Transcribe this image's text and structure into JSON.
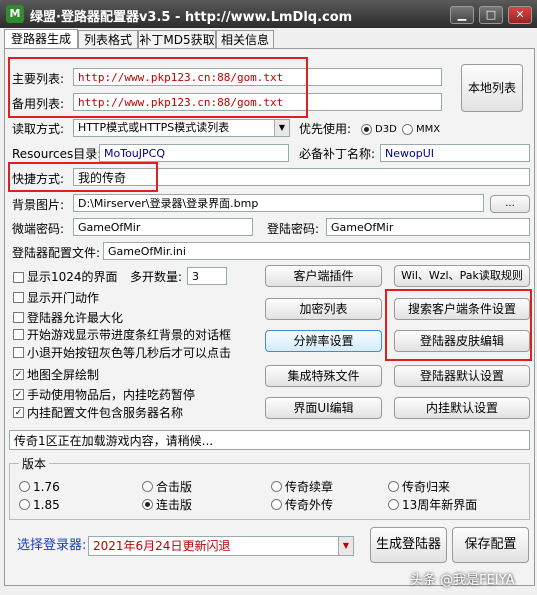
{
  "window": {
    "title": "绿盟·登路器配置器v3.5 - http://www.LmDlq.com",
    "icon_letter": "M",
    "buttons": {
      "minimize": "▁",
      "maximize": "□",
      "close": "✕"
    }
  },
  "tabs": [
    {
      "label": "登路器生成",
      "active": true
    },
    {
      "label": "列表格式",
      "active": false
    },
    {
      "label": "补丁MD5获取",
      "active": false
    },
    {
      "label": "相关信息",
      "active": false
    }
  ],
  "form": {
    "main_list": {
      "label": "主要列表:",
      "value": "http://www.pkp123.cn:88/gom.txt"
    },
    "backup_list": {
      "label": "备用列表:",
      "value": "http://www.pkp123.cn:88/gom.txt"
    },
    "local_list_button": "本地列表",
    "read_mode": {
      "label": "读取方式:",
      "value": "HTTP模式或HTTPS模式读列表"
    },
    "priority": {
      "label": "优先使用:",
      "options": [
        "D3D",
        "MMX"
      ],
      "selected": "D3D"
    },
    "resources": {
      "label": "Resources目录:",
      "value": "MoTouJPCQ"
    },
    "required_patch": {
      "label": "必备补丁名称:",
      "value": "NewopUI"
    },
    "shortcut": {
      "label": "快捷方式:",
      "value": "我的传奇"
    },
    "background": {
      "label": "背景图片:",
      "value": "D:\\Mirserver\\登录器\\登录界面.bmp",
      "browse": "..."
    },
    "micro_password": {
      "label": "微端密码:",
      "value": "GameOfMir"
    },
    "login_password": {
      "label": "登陆密码:",
      "value": "GameOfMir"
    },
    "config_file": {
      "label": "登陆器配置文件:",
      "value": "GameOfMir.ini"
    }
  },
  "options": [
    {
      "label": "显示1024的界面",
      "checked": false
    },
    {
      "label": "显示开门动作",
      "checked": false
    },
    {
      "label": "登陆器允许最大化",
      "checked": false
    },
    {
      "label": "开始游戏显示带进度条红背景的对话框",
      "checked": false
    },
    {
      "label": "小退开始按钮灰色等几秒后才可以点击",
      "checked": false
    },
    {
      "label": "地图全屏绘制",
      "checked": true
    },
    {
      "label": "手动使用物品后，内挂吃药暂停",
      "checked": true
    },
    {
      "label": "内挂配置文件包含服务器名称",
      "checked": true
    }
  ],
  "multi_open": {
    "label": "多开数量:",
    "value": "3"
  },
  "buttons": {
    "client_plugin": "客户端插件",
    "wil_rule": "Wil、Wzl、Pak读取规则",
    "encrypt_list": "加密列表",
    "search_client": "搜索客户端条件设置",
    "resolution": "分辨率设置",
    "skin_edit": "登陆器皮肤编辑",
    "integrate_files": "集成特殊文件",
    "default_settings": "登陆器默认设置",
    "ui_edit": "界面UI编辑",
    "plugin_default": "内挂默认设置"
  },
  "status_text": "传奇1区正在加载游戏内容，请稍候...",
  "version": {
    "label": "版本",
    "options": [
      "1.76",
      "合击版",
      "传奇续章",
      "传奇归来",
      "1.85",
      "连击版",
      "传奇外传",
      "13周年新界面"
    ],
    "selected": "连击版"
  },
  "bottom": {
    "select_label": "选择登录器:",
    "select_value": "2021年6月24日更新闪退",
    "generate": "生成登陆器",
    "save": "保存配置"
  },
  "watermark": "头条 @我是FEIYA",
  "colors": {
    "highlight_box": "#e02020",
    "link_blue": "#00008b",
    "value_red": "#c00000"
  }
}
